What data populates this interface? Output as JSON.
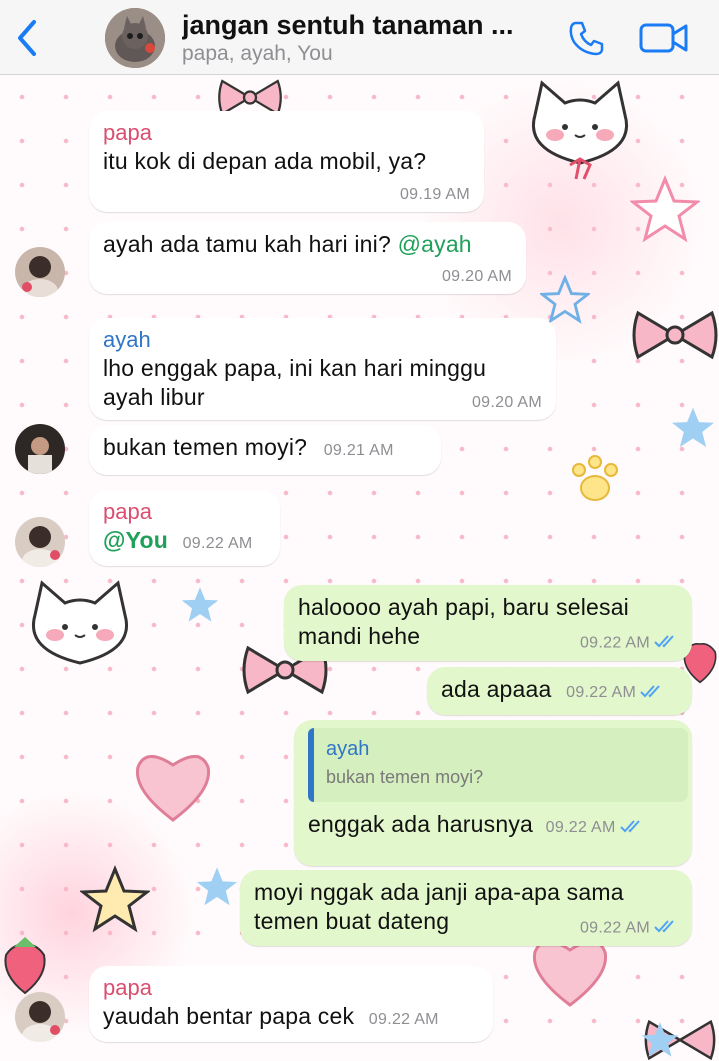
{
  "header": {
    "title": "jangan sentuh tanaman ...",
    "subtitle": "papa, ayah, You",
    "accent": "#1a7cf5"
  },
  "messages": [
    {
      "direction": "in",
      "sender": "papa",
      "text": "itu kok di depan ada mobil, ya?",
      "time": "09.19 AM"
    },
    {
      "direction": "in",
      "text": "ayah ada tamu kah hari ini?",
      "mention": "@ayah",
      "time": "09.20 AM"
    },
    {
      "direction": "in",
      "sender": "ayah",
      "text_line1": "lho enggak papa, ini kan hari minggu",
      "text_line2": "ayah libur",
      "time": "09.20 AM"
    },
    {
      "direction": "in",
      "text": "bukan temen moyi?",
      "time": "09.21 AM"
    },
    {
      "direction": "in",
      "sender": "papa",
      "mention": "@You",
      "time": "09.22 AM"
    },
    {
      "direction": "out",
      "text_line1": "haloooo ayah papi, baru selesai",
      "text_line2": "mandi hehe",
      "time": "09.22 AM",
      "status": "read"
    },
    {
      "direction": "out",
      "text": "ada apaaa",
      "time": "09.22 AM",
      "status": "read"
    },
    {
      "direction": "out",
      "reply_sender": "ayah",
      "reply_text": "bukan temen moyi?",
      "text": "enggak ada harusnya",
      "time": "09.22 AM",
      "status": "read"
    },
    {
      "direction": "out",
      "text_line1": "moyi nggak ada janji apa-apa sama",
      "text_line2": "temen buat dateng",
      "time": "09.22 AM",
      "status": "read"
    },
    {
      "direction": "in",
      "sender": "papa",
      "text": "yaudah bentar papa cek",
      "time": "09.22 AM"
    }
  ],
  "colors": {
    "incoming_bubble": "#ffffff",
    "outgoing_bubble": "#e2f7cb",
    "papa_name": "#d94f6f",
    "ayah_name": "#2f76c7",
    "mention": "#20a05a",
    "read_ticks": "#4fa3f7"
  }
}
